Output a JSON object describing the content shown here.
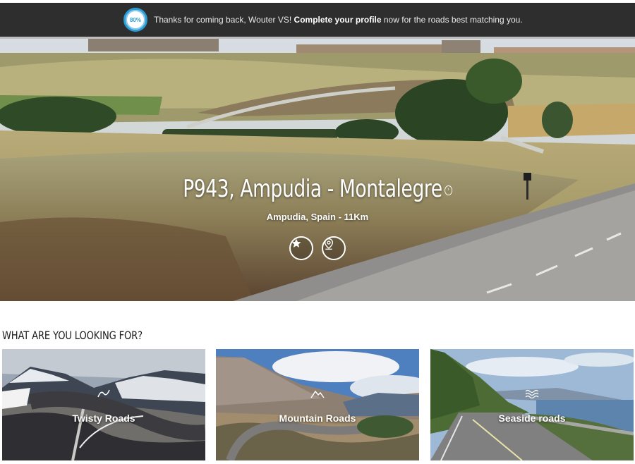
{
  "banner": {
    "progress": "80%",
    "prefix": "Thanks for coming back, Wouter VS! ",
    "cta": "Complete your profile",
    "suffix": " now for the roads best matching you."
  },
  "hero": {
    "title": "P943, Ampudia - Montalegre",
    "subtitle": "Ampudia, Spain - 11Km"
  },
  "section": {
    "title": "WHAT ARE YOU LOOKING FOR?"
  },
  "categories": [
    {
      "label": "Twisty Roads",
      "icon": "curve-icon"
    },
    {
      "label": "Mountain Roads",
      "icon": "mountain-icon"
    },
    {
      "label": "Seaside roads",
      "icon": "waves-icon"
    }
  ],
  "colors": {
    "banner_bg": "#2e2e2e",
    "accent": "#2a9fd6"
  }
}
